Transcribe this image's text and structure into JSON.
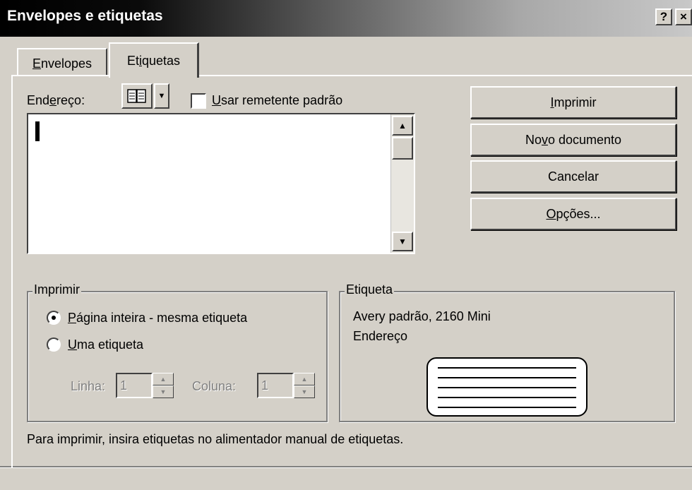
{
  "window": {
    "title": "Envelopes e etiquetas",
    "help_button": "?",
    "close_button": "×"
  },
  "tabs": [
    {
      "label_pre": "",
      "label_ul": "E",
      "label_post": "nvelopes",
      "active": false
    },
    {
      "label_pre": "Et",
      "label_ul": "i",
      "label_post": "quetas",
      "active": true
    }
  ],
  "address": {
    "label_pre": "End",
    "label_ul": "e",
    "label_post": "reço:",
    "book_icon": "address-book-icon",
    "checkbox_pre": "",
    "checkbox_ul": "U",
    "checkbox_post": "sar remetente padrão",
    "checkbox_checked": false,
    "value": ""
  },
  "buttons": [
    {
      "pre": "",
      "ul": "I",
      "post": "mprimir"
    },
    {
      "pre": "No",
      "ul": "v",
      "post": "o documento"
    },
    {
      "pre": "",
      "ul": "",
      "post": "Cancelar"
    },
    {
      "pre": "",
      "ul": "O",
      "post": "pções..."
    }
  ],
  "print_group": {
    "legend": "Imprimir",
    "option_full_pre": "",
    "option_full_ul": "P",
    "option_full_post": "ágina inteira - mesma etiqueta",
    "option_single_pre": "",
    "option_single_ul": "U",
    "option_single_post": "ma etiqueta",
    "selected": "full",
    "row_label": "Linha:",
    "row_value": "1",
    "col_label": "Coluna:",
    "col_value": "1"
  },
  "label_group": {
    "legend": "Etiqueta",
    "line1": "Avery padrão, 2160 Mini",
    "line2": "Endereço"
  },
  "footer_note": "Para imprimir, insira etiquetas no alimentador manual de etiquetas."
}
